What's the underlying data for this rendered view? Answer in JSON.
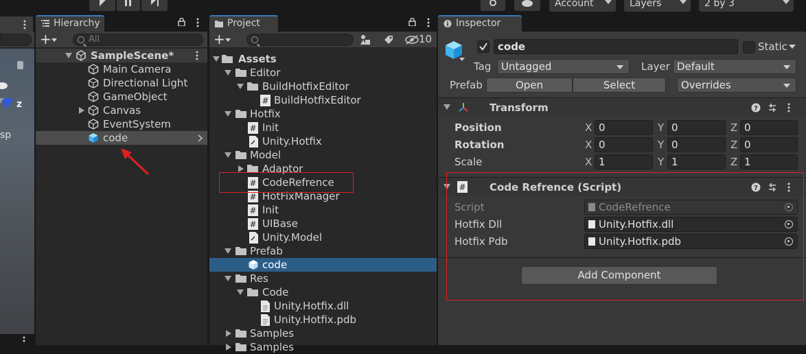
{
  "toolbar": {
    "account_label": "Account",
    "layers_label": "Layers",
    "layout_label": "2 by 3"
  },
  "scene_view": {
    "axis_z": "z",
    "persp_label": "sp"
  },
  "hierarchy": {
    "tab_label": "Hierarchy",
    "search_placeholder": "All",
    "scene_name": "SampleScene*",
    "items": [
      {
        "label": "Main Camera"
      },
      {
        "label": "Directional Light"
      },
      {
        "label": "GameObject"
      },
      {
        "label": "Canvas"
      },
      {
        "label": "EventSystem"
      },
      {
        "label": "code"
      }
    ]
  },
  "project": {
    "tab_label": "Project",
    "search_placeholder": "",
    "hidden_count": "10",
    "tree": [
      {
        "label": "Assets"
      },
      {
        "label": "Editor"
      },
      {
        "label": "BuildHotfixEditor"
      },
      {
        "label": "BuildHotfixEditor"
      },
      {
        "label": "Hotfix"
      },
      {
        "label": "Init"
      },
      {
        "label": "Unity.Hotfix"
      },
      {
        "label": "Model"
      },
      {
        "label": "Adaptor"
      },
      {
        "label": "CodeRefrence"
      },
      {
        "label": "HotFixManager"
      },
      {
        "label": "Init"
      },
      {
        "label": "UIBase"
      },
      {
        "label": "Unity.Model"
      },
      {
        "label": "Prefab"
      },
      {
        "label": "code"
      },
      {
        "label": "Res"
      },
      {
        "label": "Code"
      },
      {
        "label": "Unity.Hotfix.dll"
      },
      {
        "label": "Unity.Hotfix.pdb"
      },
      {
        "label": "Samples"
      },
      {
        "label": "Samples"
      }
    ]
  },
  "inspector": {
    "tab_label": "Inspector",
    "object_name": "code",
    "static_label": "Static",
    "tag_label": "Tag",
    "tag_value": "Untagged",
    "layer_label": "Layer",
    "layer_value": "Default",
    "prefab_label": "Prefab",
    "open_label": "Open",
    "select_label": "Select",
    "overrides_label": "Overrides",
    "transform": {
      "title": "Transform",
      "position_label": "Position",
      "rotation_label": "Rotation",
      "scale_label": "Scale",
      "axis_x": "X",
      "axis_y": "Y",
      "axis_z": "Z",
      "position": [
        "0",
        "0",
        "0"
      ],
      "rotation": [
        "0",
        "0",
        "0"
      ],
      "scale": [
        "1",
        "1",
        "1"
      ]
    },
    "code_refrence": {
      "title": "Code Refrence (Script)",
      "script_label": "Script",
      "script_value": "CodeRefrence",
      "dll_label": "Hotfix Dll",
      "dll_value": "Unity.Hotfix.dll",
      "pdb_label": "Hotfix Pdb",
      "pdb_value": "Unity.Hotfix.pdb"
    },
    "add_component_label": "Add Component"
  },
  "colors": {
    "selection": "#2c5d87",
    "accent": "#3a79bb",
    "annotation_red": "#e02020"
  }
}
